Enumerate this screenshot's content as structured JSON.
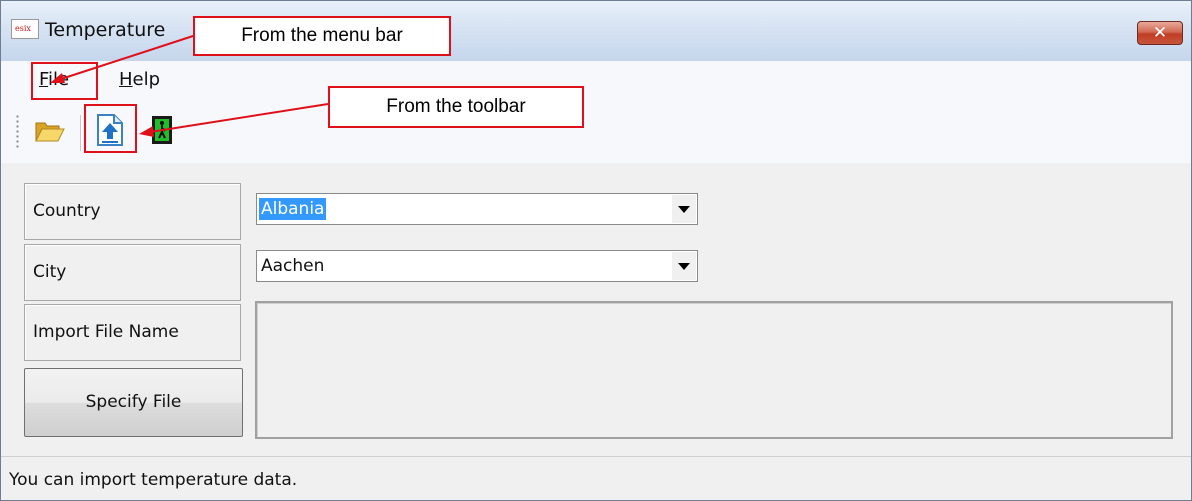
{
  "window": {
    "title": "Temperature",
    "close_glyph": "✕"
  },
  "menu": {
    "items": [
      {
        "accel": "F",
        "rest": "ile"
      },
      {
        "accel": "H",
        "rest": "elp"
      }
    ]
  },
  "toolbar": {
    "icons": [
      "open-folder-icon",
      "import-file-icon",
      "exit-door-icon"
    ]
  },
  "form": {
    "country_label": "Country",
    "country_value": "Albania",
    "city_label": "City",
    "city_value": "Aachen",
    "import_label": "Import File Name",
    "import_value": "",
    "specify_button": "Specify File"
  },
  "status": {
    "text": "You can import temperature data."
  },
  "annotations": {
    "menu_callout": "From the menu bar",
    "toolbar_callout": "From the toolbar",
    "color": "#e0101a"
  }
}
